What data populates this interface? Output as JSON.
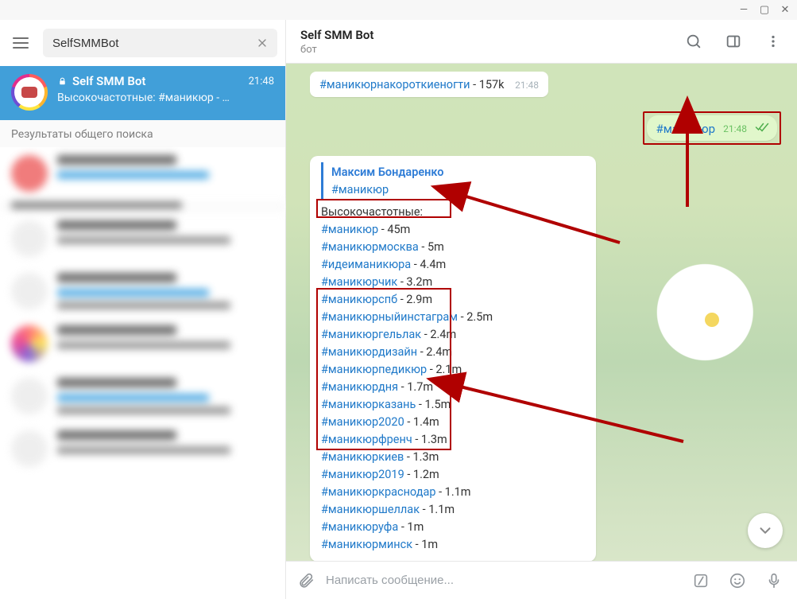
{
  "titlebar": {
    "min": "—",
    "max": "▢",
    "close": "✕"
  },
  "search": {
    "value": "SelfSMMBot"
  },
  "active_chat": {
    "title": "Self SMM Bot",
    "time": "21:48",
    "subtitle": "Высокочастотные: #маникюр - …"
  },
  "section_label": "Результаты общего поиска",
  "header": {
    "title": "Self SMM Bot",
    "subtitle": "бот"
  },
  "msg_top": {
    "tag": "#маникюрнакороткиеногти",
    "count": " - 157k",
    "time": "21:48"
  },
  "msg_out": {
    "tag": "#маникюр",
    "time": "21:48"
  },
  "reply": {
    "author": "Максим Бондаренко",
    "hashtag": "#маникюр",
    "section": "Высокочастотные:",
    "lines": [
      {
        "tag": "#маникюр",
        "rest": " - 45m"
      },
      {
        "tag": "#маникюрмосква",
        "rest": " - 5m"
      },
      {
        "tag": "#идеиманикюра",
        "rest": " - 4.4m"
      },
      {
        "tag": "#маникюрчик",
        "rest": " - 3.2m"
      },
      {
        "tag": "#маникюрспб",
        "rest": " - 2.9m"
      },
      {
        "tag": "#маникюрныйинстаграм",
        "rest": " - 2.5m"
      },
      {
        "tag": "#маникюргельлак",
        "rest": " - 2.4m"
      },
      {
        "tag": "#маникюрдизайн",
        "rest": " - 2.4m"
      },
      {
        "tag": "#маникюрпедикюр",
        "rest": " - 2.1m"
      },
      {
        "tag": "#маникюрдня",
        "rest": " - 1.7m"
      },
      {
        "tag": "#маникюрказань",
        "rest": " - 1.5m"
      },
      {
        "tag": "#маникюр2020",
        "rest": " - 1.4m"
      },
      {
        "tag": "#маникюрфренч",
        "rest": " - 1.3m"
      },
      {
        "tag": "#маникюркиев",
        "rest": " - 1.3m"
      },
      {
        "tag": "#маникюр2019",
        "rest": " - 1.2m"
      },
      {
        "tag": "#маникюркраснодар",
        "rest": " - 1.1m"
      },
      {
        "tag": "#маникюршеллак",
        "rest": " - 1.1m"
      },
      {
        "tag": "#маникюруфа",
        "rest": " - 1m"
      },
      {
        "tag": "#маникюрминск",
        "rest": " - 1m"
      }
    ]
  },
  "compose": {
    "placeholder": "Написать сообщение..."
  }
}
